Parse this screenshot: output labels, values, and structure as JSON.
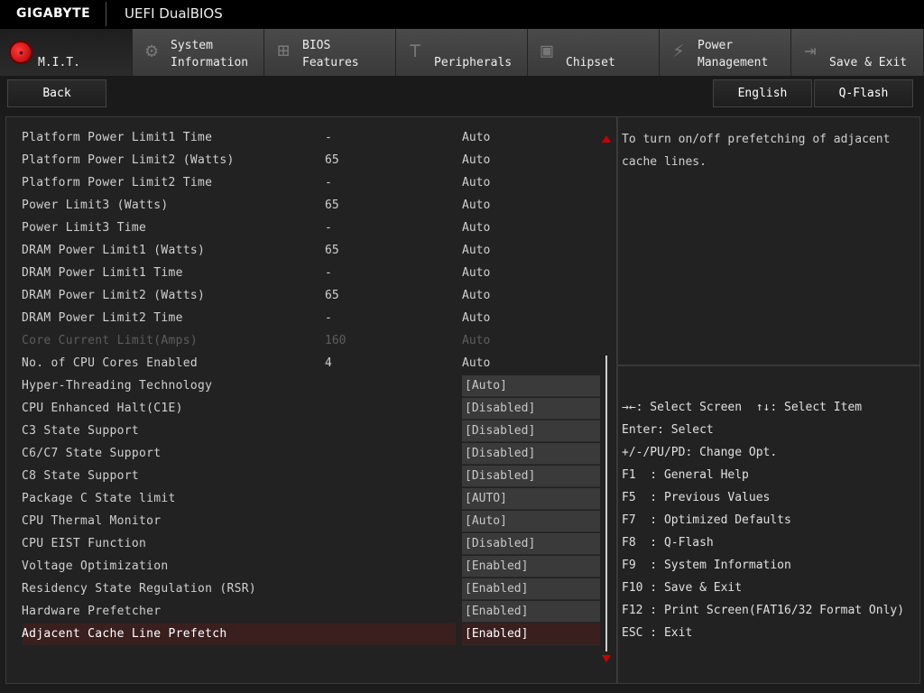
{
  "header": {
    "brand": "GIGABYTE",
    "title": "UEFI DualBIOS"
  },
  "tabs": [
    {
      "label": "M.I.T.",
      "icon": "mit-dot-icon",
      "active": true
    },
    {
      "label": "System\nInformation",
      "icon": "gear-icon"
    },
    {
      "label": "BIOS\nFeatures",
      "icon": "chip-plus-icon"
    },
    {
      "label": "Peripherals",
      "icon": "peripherals-icon"
    },
    {
      "label": "Chipset",
      "icon": "chipset-icon"
    },
    {
      "label": "Power\nManagement",
      "icon": "power-icon"
    },
    {
      "label": "Save & Exit",
      "icon": "exit-icon"
    }
  ],
  "toolbar": {
    "back": "Back",
    "language": "English",
    "qflash": "Q-Flash"
  },
  "settings": [
    {
      "name": "Platform Power Limit1 Time",
      "current": "-",
      "value": "Auto"
    },
    {
      "name": "Platform Power Limit2 (Watts)",
      "current": "65",
      "value": "Auto"
    },
    {
      "name": "Platform Power Limit2 Time",
      "current": "-",
      "value": "Auto"
    },
    {
      "name": "Power Limit3 (Watts)",
      "current": "65",
      "value": "Auto"
    },
    {
      "name": "Power Limit3 Time",
      "current": "-",
      "value": "Auto"
    },
    {
      "name": "DRAM Power Limit1 (Watts)",
      "current": "65",
      "value": "Auto"
    },
    {
      "name": "DRAM Power Limit1 Time",
      "current": "-",
      "value": "Auto"
    },
    {
      "name": "DRAM Power Limit2 (Watts)",
      "current": "65",
      "value": "Auto"
    },
    {
      "name": "DRAM Power Limit2 Time",
      "current": "-",
      "value": "Auto"
    },
    {
      "name": "Core Current Limit(Amps)",
      "current": "160",
      "value": "Auto",
      "disabled": true
    },
    {
      "name": "No. of CPU Cores Enabled",
      "current": "4",
      "value": "Auto"
    },
    {
      "name": "Hyper-Threading Technology",
      "value": "[Auto]",
      "option": true
    },
    {
      "name": "CPU Enhanced Halt(C1E)",
      "value": "[Disabled]",
      "option": true
    },
    {
      "name": "C3 State Support",
      "value": "[Disabled]",
      "option": true
    },
    {
      "name": "C6/C7 State Support",
      "value": "[Disabled]",
      "option": true
    },
    {
      "name": "C8 State Support",
      "value": "[Disabled]",
      "option": true
    },
    {
      "name": "Package C State limit",
      "value": "[AUTO]",
      "option": true
    },
    {
      "name": "CPU Thermal Monitor",
      "value": "[Auto]",
      "option": true
    },
    {
      "name": "CPU EIST Function",
      "value": "[Disabled]",
      "option": true
    },
    {
      "name": "Voltage Optimization",
      "value": "[Enabled]",
      "option": true
    },
    {
      "name": "Residency State Regulation (RSR)",
      "value": "[Enabled]",
      "option": true
    },
    {
      "name": "Hardware Prefetcher",
      "value": "[Enabled]",
      "option": true
    },
    {
      "name": "Adjacent Cache Line Prefetch",
      "value": "[Enabled]",
      "option": true,
      "selected": true
    }
  ],
  "help": {
    "text": "To turn on/off prefetching of adjacent cache lines."
  },
  "keys": [
    "→←: Select Screen  ↑↓: Select Item",
    "Enter: Select",
    "+/-/PU/PD: Change Opt.",
    "F1  : General Help",
    "F5  : Previous Values",
    "F7  : Optimized Defaults",
    "F8  : Q-Flash",
    "F9  : System Information",
    "F10 : Save & Exit",
    "F12 : Print Screen(FAT16/32 Format Only)",
    "ESC : Exit"
  ],
  "colors": {
    "accent": "#cc0000",
    "selection": "#3a1f1f",
    "panel": "#222222"
  }
}
